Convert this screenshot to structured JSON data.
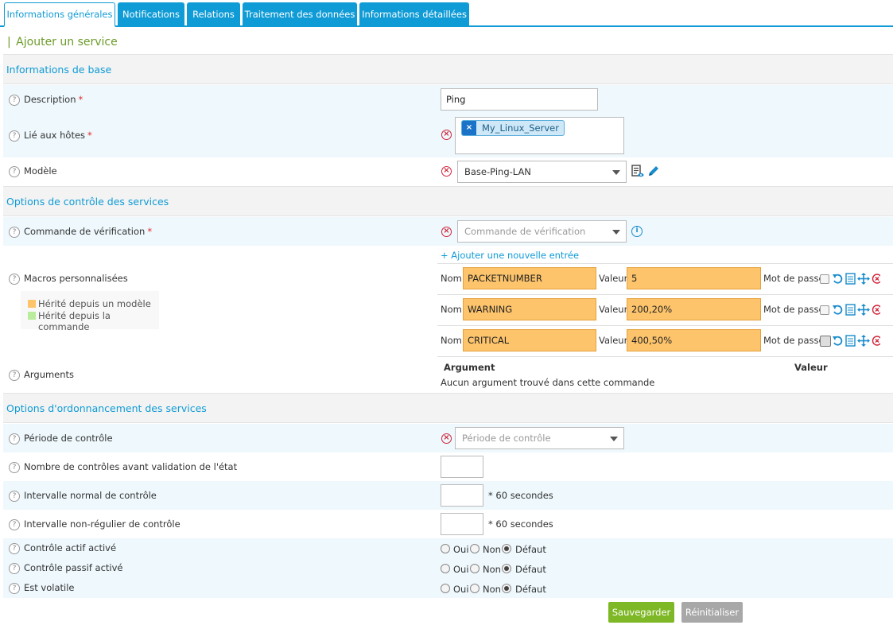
{
  "tabs": [
    {
      "label": "Informations générales",
      "active": true
    },
    {
      "label": "Notifications"
    },
    {
      "label": "Relations"
    },
    {
      "label": "Traitement des données"
    },
    {
      "label": "Informations détaillées"
    }
  ],
  "page_title": "Ajouter un service",
  "sections": {
    "base": "Informations de base",
    "control": "Options de contrôle des services",
    "scheduling": "Options d'ordonnancement des services"
  },
  "fields": {
    "description": {
      "label": "Description",
      "value": "Ping"
    },
    "linked_hosts": {
      "label": "Lié aux hôtes",
      "chips": [
        "My_Linux_Server"
      ]
    },
    "template": {
      "label": "Modèle",
      "value": "Base-Ping-LAN"
    },
    "check_command": {
      "label": "Commande de vérification",
      "placeholder": "Commande de vérification"
    },
    "macros": {
      "label": "Macros personnalisées",
      "add_entry": "+ Ajouter une nouvelle entrée",
      "name_label": "Nom",
      "value_label": "Valeur",
      "password_label": "Mot de passe",
      "items": [
        {
          "name": "PACKETNUMBER",
          "value": "5"
        },
        {
          "name": "WARNING",
          "value": "200,20%"
        },
        {
          "name": "CRITICAL",
          "value": "400,50%"
        }
      ],
      "legend": [
        {
          "label": "Hérité depuis un modèle",
          "color": "#fdc46c"
        },
        {
          "label": "Hérité depuis la commande",
          "color": "#b9ec9c"
        }
      ]
    },
    "arguments": {
      "label": "Arguments",
      "col_argument": "Argument",
      "col_value": "Valeur",
      "empty_text": "Aucun argument trouvé dans cette commande"
    },
    "check_period": {
      "label": "Période de contrôle",
      "placeholder": "Période de contrôle"
    },
    "max_check_attempts": {
      "label": "Nombre de contrôles avant validation de l'état"
    },
    "normal_interval": {
      "label": "Intervalle normal de contrôle",
      "unit": "* 60 secondes"
    },
    "retry_interval": {
      "label": "Intervalle non-régulier de contrôle",
      "unit": "* 60 secondes"
    },
    "active_checks": {
      "label": "Contrôle actif activé",
      "selected": "Défaut"
    },
    "passive_checks": {
      "label": "Contrôle passif activé",
      "selected": "Défaut"
    },
    "volatile": {
      "label": "Est volatile",
      "selected": "Défaut"
    }
  },
  "radio_options": {
    "yes": "Oui",
    "no": "Non",
    "default": "Défaut"
  },
  "buttons": {
    "save": "Sauvegarder",
    "reset": "Réinitialiser"
  },
  "colors": {
    "accent": "#0f9bd6",
    "title": "#6c9b2a",
    "save": "#7fb827",
    "reset": "#a8a8a8",
    "macro": "#fdc46c"
  },
  "help_glyph": "?",
  "required_mark": "*"
}
